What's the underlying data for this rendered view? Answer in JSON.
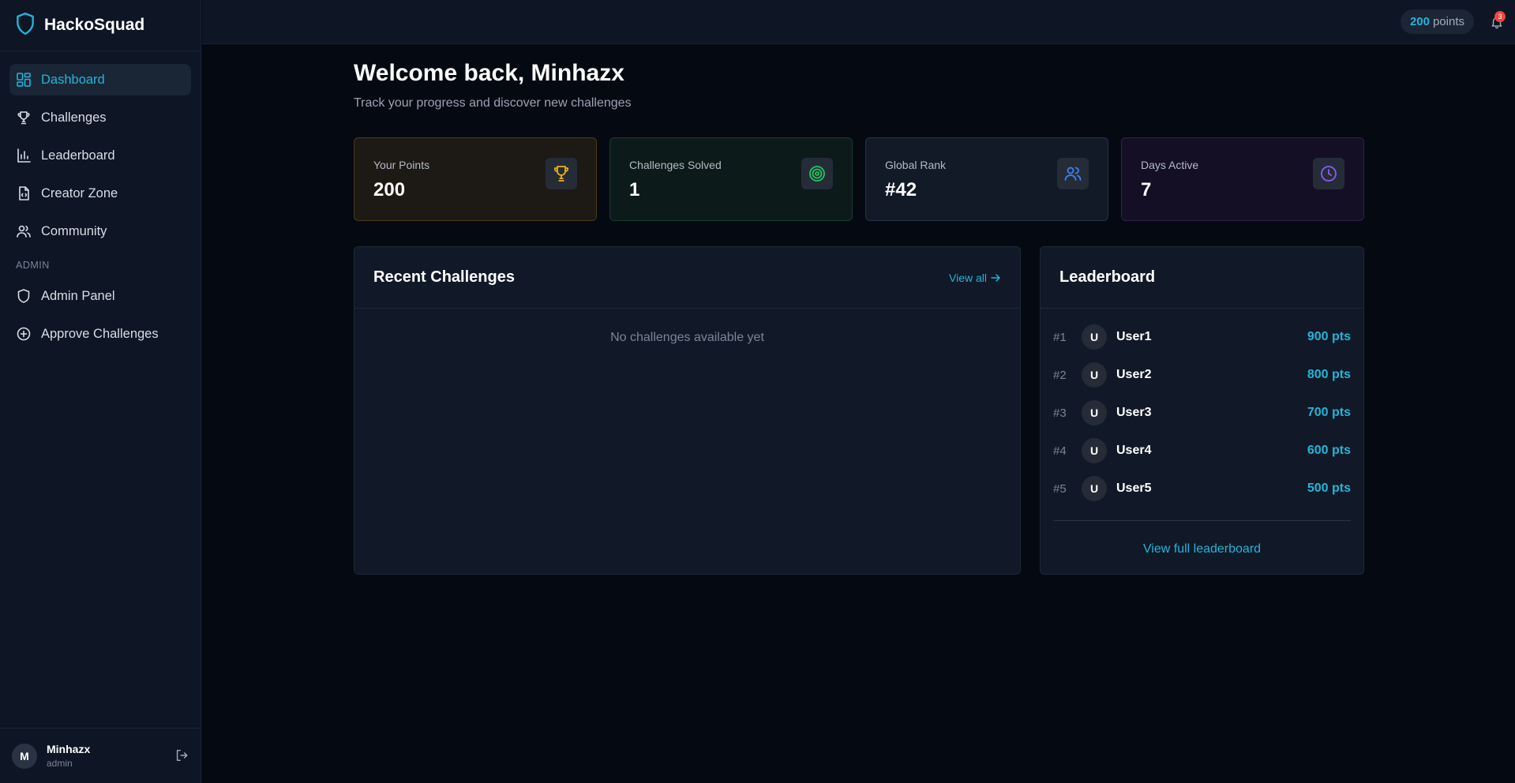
{
  "brand": {
    "name": "HackoSquad",
    "accent": "#22b5d8"
  },
  "sidebar": {
    "items": [
      {
        "label": "Dashboard",
        "icon": "dashboard-icon",
        "active": true
      },
      {
        "label": "Challenges",
        "icon": "trophy-icon"
      },
      {
        "label": "Leaderboard",
        "icon": "bar-chart-icon"
      },
      {
        "label": "Creator Zone",
        "icon": "code-file-icon"
      },
      {
        "label": "Community",
        "icon": "users-icon"
      }
    ],
    "admin_label": "ADMIN",
    "admin_items": [
      {
        "label": "Admin Panel",
        "icon": "shield-icon"
      },
      {
        "label": "Approve Challenges",
        "icon": "plus-circle-icon"
      }
    ],
    "user": {
      "initial": "M",
      "name": "Minhazx",
      "role": "admin"
    }
  },
  "topbar": {
    "points_value": "200",
    "points_label": "points",
    "notifications_count": "3"
  },
  "main": {
    "welcome": "Welcome back, Minhazx",
    "subtitle": "Track your progress and discover new challenges",
    "stats": [
      {
        "label": "Your Points",
        "value": "200",
        "icon": "trophy-icon",
        "color": "#eab308"
      },
      {
        "label": "Challenges Solved",
        "value": "1",
        "icon": "target-icon",
        "color": "#22c55e"
      },
      {
        "label": "Global Rank",
        "value": "#42",
        "icon": "users-icon",
        "color": "#3b82f6"
      },
      {
        "label": "Days Active",
        "value": "7",
        "icon": "clock-icon",
        "color": "#8b5cf6"
      }
    ],
    "recent": {
      "title": "Recent Challenges",
      "view_all": "View all",
      "empty": "No challenges available yet"
    },
    "leaderboard": {
      "title": "Leaderboard",
      "rows": [
        {
          "rank": "#1",
          "initial": "U",
          "name": "User1",
          "points": "900 pts"
        },
        {
          "rank": "#2",
          "initial": "U",
          "name": "User2",
          "points": "800 pts"
        },
        {
          "rank": "#3",
          "initial": "U",
          "name": "User3",
          "points": "700 pts"
        },
        {
          "rank": "#4",
          "initial": "U",
          "name": "User4",
          "points": "600 pts"
        },
        {
          "rank": "#5",
          "initial": "U",
          "name": "User5",
          "points": "500 pts"
        }
      ],
      "view_full": "View full leaderboard"
    }
  }
}
